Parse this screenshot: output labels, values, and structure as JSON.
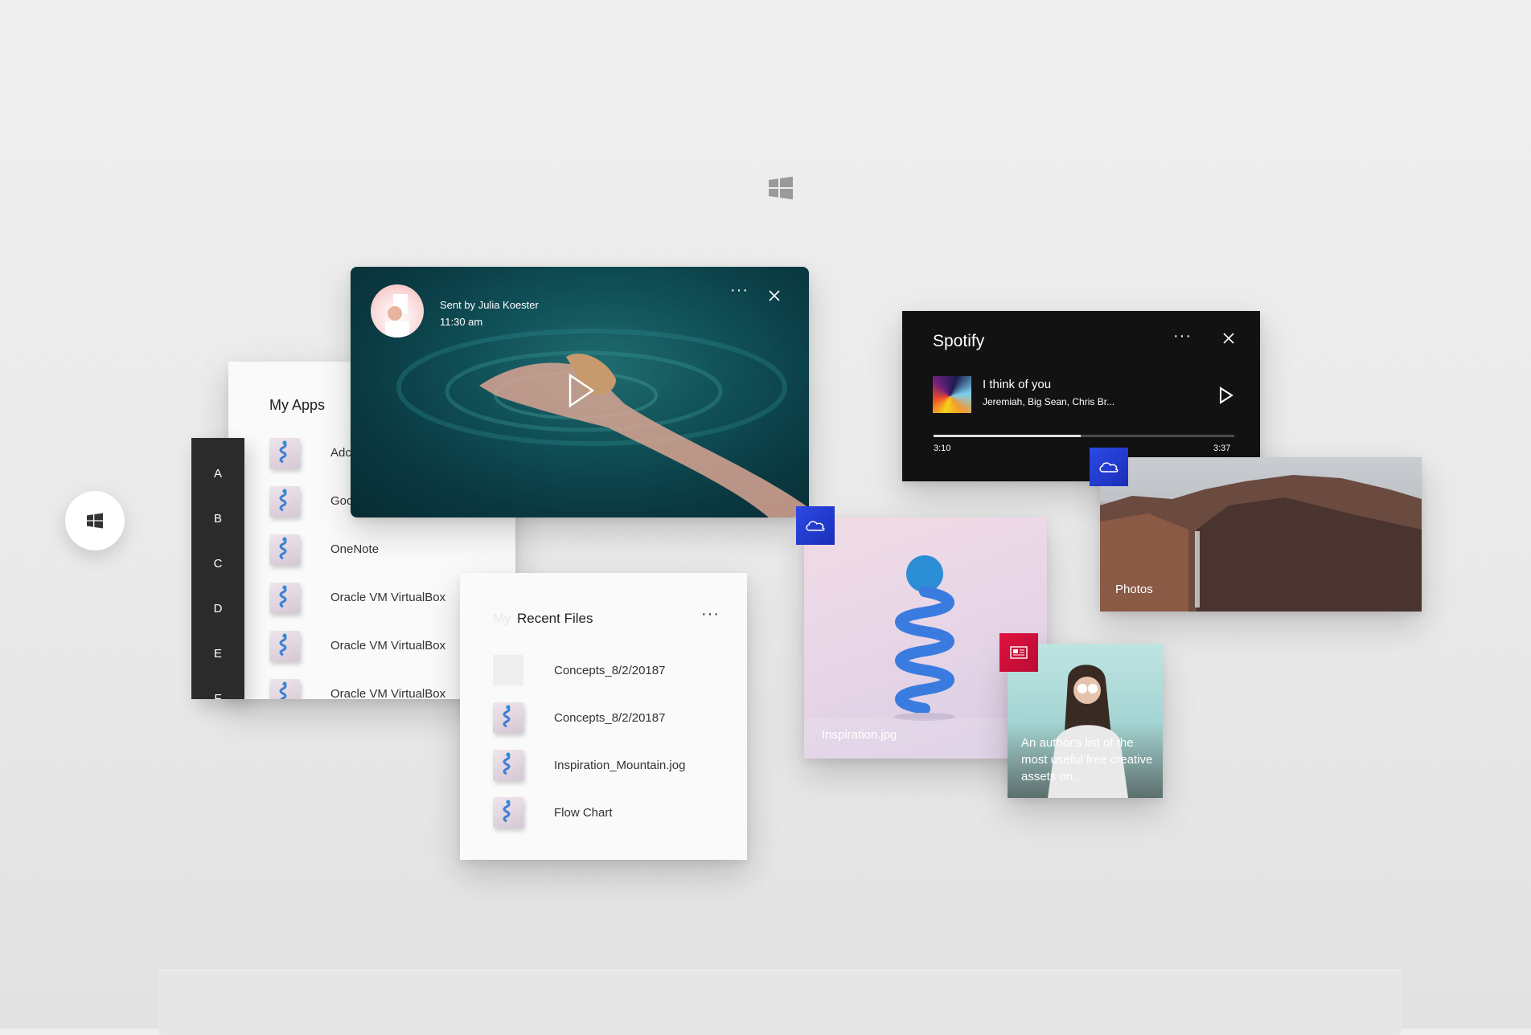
{
  "my_apps": {
    "title": "My Apps",
    "items": [
      {
        "label": "Adc"
      },
      {
        "label": "Goc"
      },
      {
        "label": "OneNote"
      },
      {
        "label": "Oracle VM VirtualBox"
      },
      {
        "label": "Oracle VM VirtualBox"
      },
      {
        "label": "Oracle VM VirtualBox"
      }
    ]
  },
  "letter_rail": {
    "letters": [
      "A",
      "B",
      "C",
      "D",
      "E",
      "F"
    ]
  },
  "video_message": {
    "sender": "Sent by Julia Koester",
    "time": "11:30 am",
    "more_label": "···"
  },
  "recent_files": {
    "ghost_prefix": "My",
    "title": "Recent Files",
    "more_label": "···",
    "items": [
      {
        "label": "Concepts_8/2/20187"
      },
      {
        "label": "Concepts_8/2/20187"
      },
      {
        "label": "Inspiration_Mountain.jog"
      },
      {
        "label": "Flow Chart"
      }
    ]
  },
  "spotify": {
    "title": "Spotify",
    "more_label": "···",
    "track": "I think of you",
    "artist": "Jeremiah, Big Sean, Chris Br...",
    "elapsed": "3:10",
    "duration": "3:37",
    "progress": 0.49
  },
  "photos_card": {
    "label": "Photos"
  },
  "inspiration_card": {
    "label": "Inspiration.jpg"
  },
  "news_card": {
    "headline": "An author's list of the most useful free creative assets on..."
  },
  "colors": {
    "onedrive_badge": "#2b49e6",
    "news_badge": "#e2123f",
    "dark_panel": "#121212",
    "letter_rail": "#2b2b2b"
  },
  "icons": {
    "top": "windows-logo-icon",
    "start": "windows-logo-icon",
    "onedrive": "cloud-icon",
    "news": "newspaper-icon"
  }
}
